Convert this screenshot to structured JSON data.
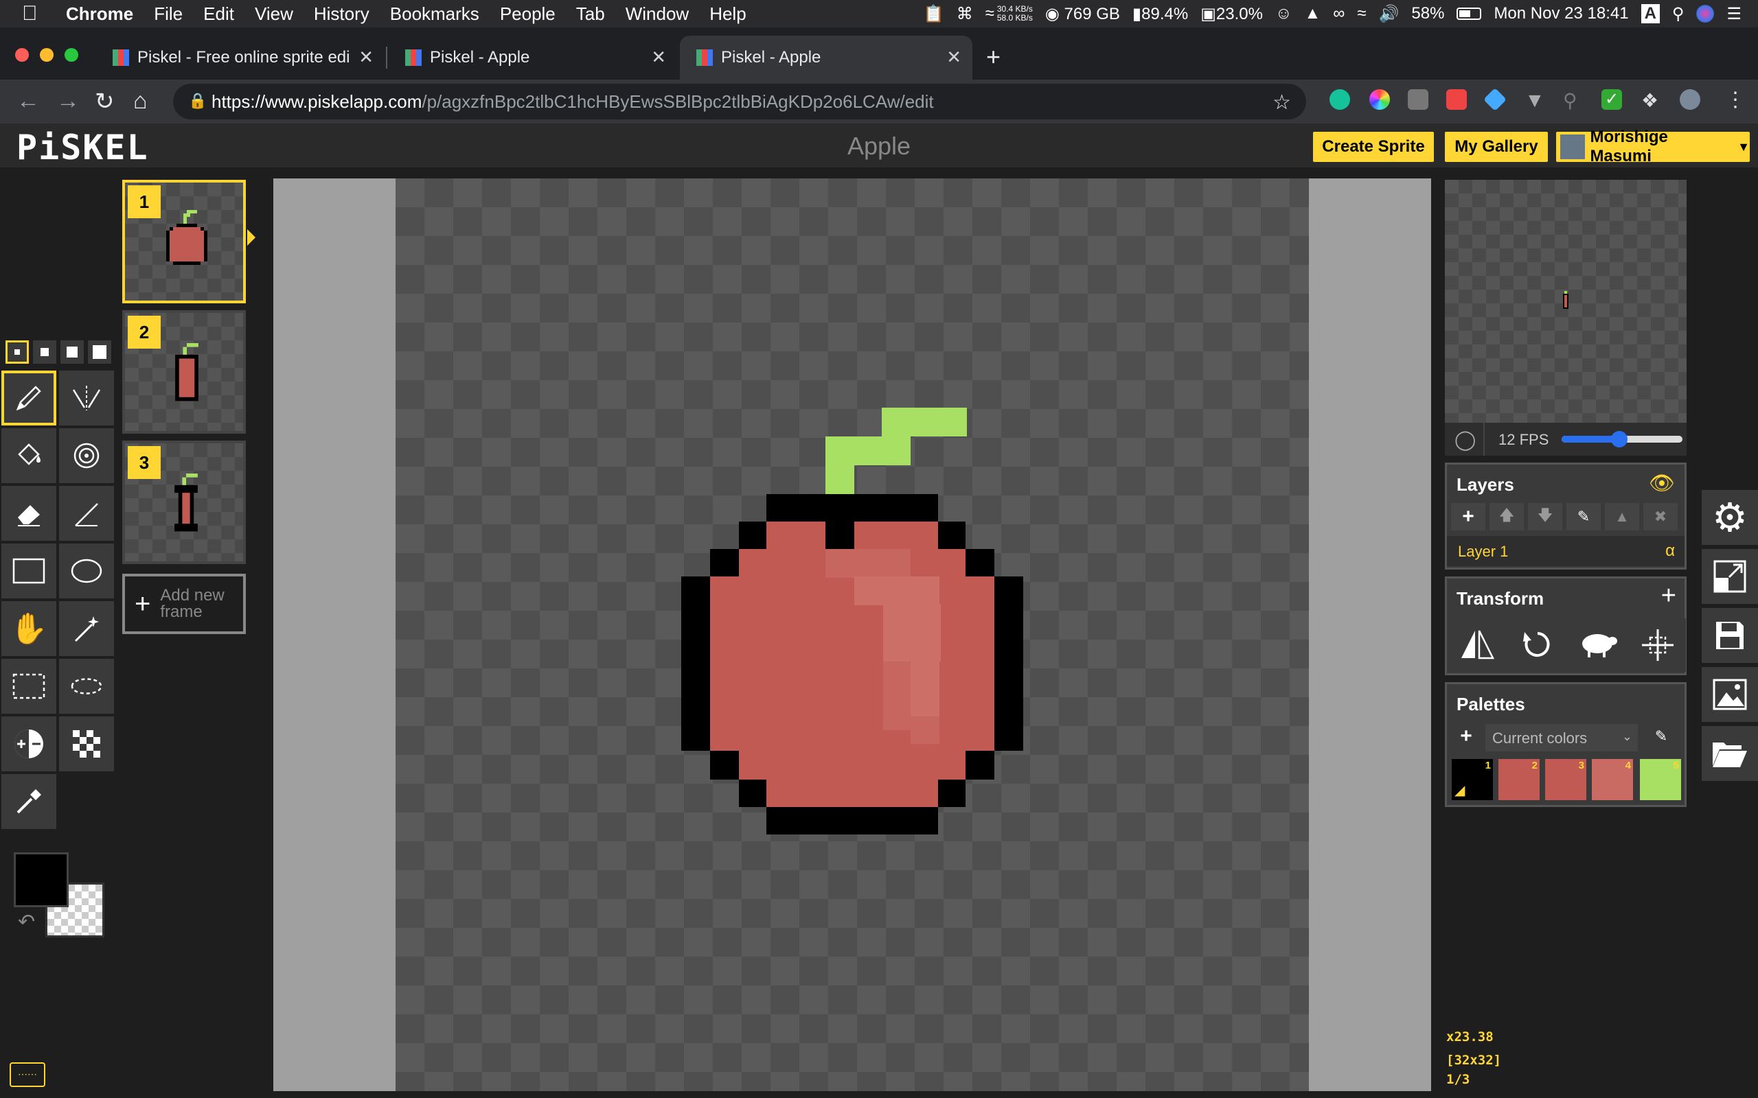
{
  "menubar": {
    "items": [
      "Chrome",
      "File",
      "Edit",
      "View",
      "History",
      "Bookmarks",
      "People",
      "Tab",
      "Window",
      "Help"
    ],
    "net_up": "30.4 KB/s",
    "net_down": "58.0 KB/s",
    "disk": "769 GB",
    "cpu": "89.4%",
    "mem": "23.0%",
    "battery": "58%",
    "datetime": "Mon Nov 23  18:41",
    "input_source": "A"
  },
  "tabs": [
    {
      "title": "Piskel - Free online sprite edito",
      "active": false
    },
    {
      "title": "Piskel - Apple",
      "active": false
    },
    {
      "title": "Piskel - Apple",
      "active": true
    }
  ],
  "address": {
    "host": "https://www.piskelapp.com",
    "path": "/p/agxzfnBpc2tlbC1hcHByEwsSBlBpc2tlbBiAgKDp2o6LCAw/edit"
  },
  "piskel": {
    "logo": "PiSKEL",
    "title": "Apple",
    "create_sprite": "Create Sprite",
    "my_gallery": "My Gallery",
    "user_name": "Morishige Masumi"
  },
  "frames": [
    {
      "number": "1"
    },
    {
      "number": "2"
    },
    {
      "number": "3"
    }
  ],
  "add_frame_label": "Add new frame",
  "fps_label": "12 FPS",
  "fps_value": 12,
  "layers": {
    "title": "Layers",
    "items": [
      "Layer 1"
    ],
    "alpha_symbol": "α"
  },
  "transform": {
    "title": "Transform"
  },
  "palettes": {
    "title": "Palettes",
    "selected": "Current colors",
    "swatches": [
      {
        "n": "1",
        "color": "#000000"
      },
      {
        "n": "2",
        "color": "#c05a52"
      },
      {
        "n": "3",
        "color": "#c05a52"
      },
      {
        "n": "4",
        "color": "#c96b63"
      },
      {
        "n": "5",
        "color": "#a8e063"
      }
    ]
  },
  "colors": {
    "primary": "#000000",
    "accent": "#ffd633",
    "apple_red": "#c05a52",
    "apple_highlight": "#cb6f67",
    "stem": "#a8e063"
  },
  "status": {
    "zoom": "x23.38",
    "size": "[32x32]",
    "frame": "1/3"
  }
}
